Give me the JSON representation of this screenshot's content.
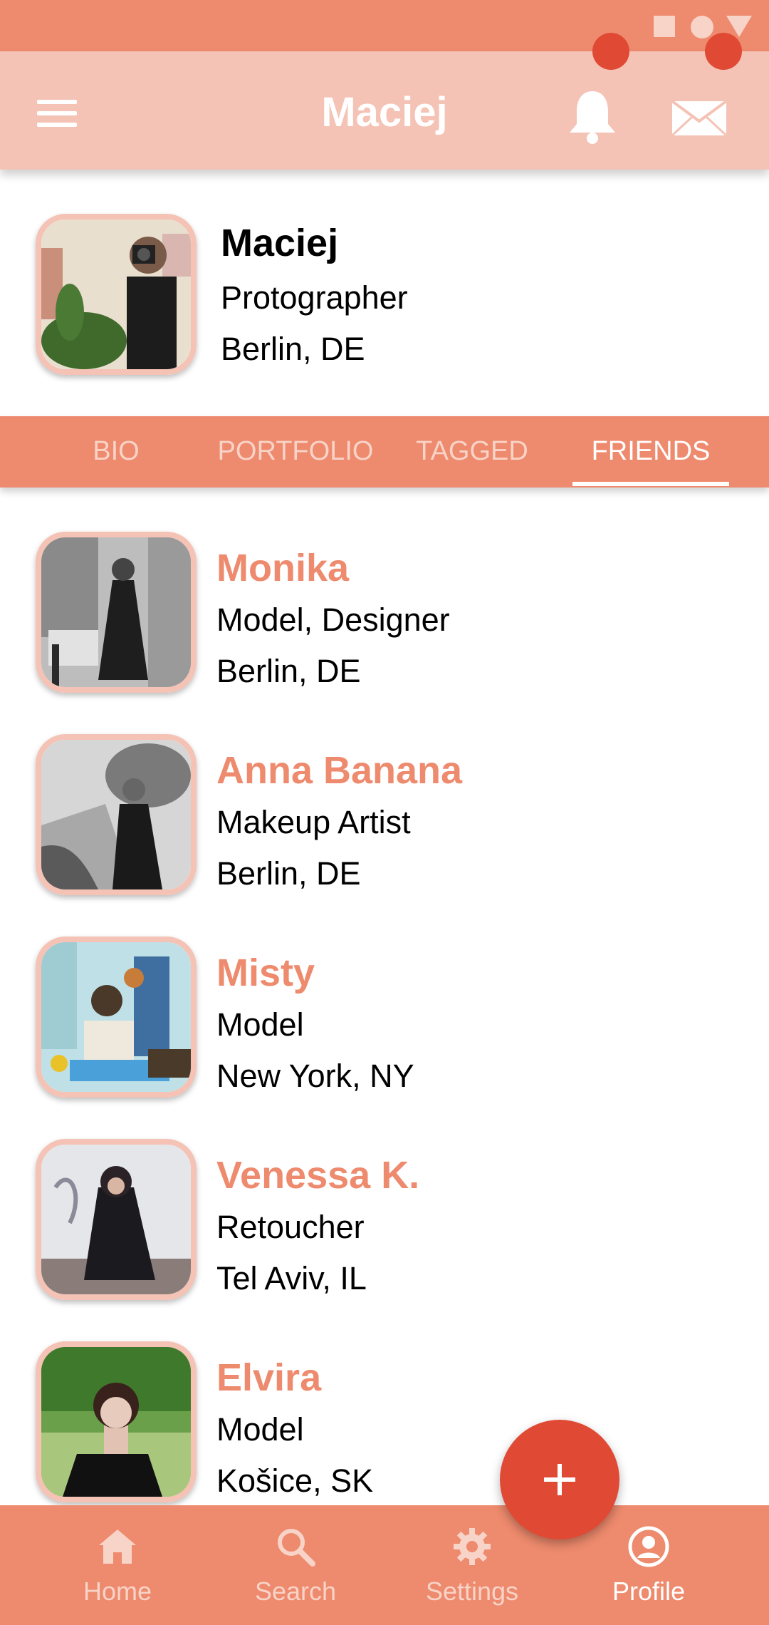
{
  "status_bar": {
    "icons": [
      "square-icon",
      "circle-icon",
      "triangle-icon"
    ]
  },
  "app_bar": {
    "title": "Maciej",
    "icons": [
      "menu-icon",
      "bell-icon",
      "mail-icon"
    ]
  },
  "profile": {
    "name": "Maciej",
    "role": "Protographer",
    "location": "Berlin, DE"
  },
  "tabs": [
    {
      "label": "BIO"
    },
    {
      "label": "PORTFOLIO"
    },
    {
      "label": "TAGGED"
    },
    {
      "label": "FRIENDS",
      "active": true
    }
  ],
  "friends": [
    {
      "name": "Monika",
      "role": "Model, Designer",
      "location": "Berlin, DE"
    },
    {
      "name": "Anna Banana",
      "role": "Makeup Artist",
      "location": "Berlin, DE"
    },
    {
      "name": "Misty",
      "role": "Model",
      "location": "New York, NY"
    },
    {
      "name": "Venessa K.",
      "role": "Retoucher",
      "location": "Tel Aviv, IL"
    },
    {
      "name": "Elvira",
      "role": "Model",
      "location": "Košice, SK"
    }
  ],
  "fab": {
    "icon": "plus-icon"
  },
  "bottom_nav": [
    {
      "label": "Home",
      "icon": "home-icon"
    },
    {
      "label": "Search",
      "icon": "search-icon"
    },
    {
      "label": "Settings",
      "icon": "gear-icon"
    },
    {
      "label": "Profile",
      "icon": "profile-icon",
      "active": true
    }
  ],
  "colors": {
    "primary": "#ee8a6d",
    "primary_light": "#f4c3b5",
    "accent": "#e04a35",
    "text": "#000000",
    "white": "#ffffff"
  }
}
